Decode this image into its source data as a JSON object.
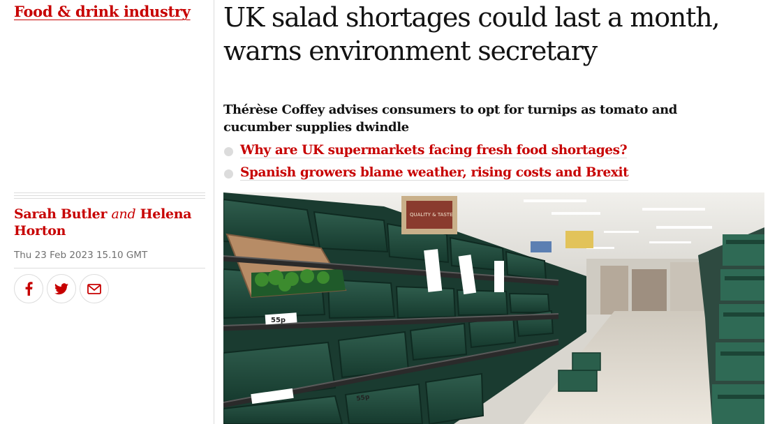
{
  "section": {
    "label": "Food & drink industry"
  },
  "article": {
    "headline_line1": "UK salad shortages could last a month,",
    "headline_line2": "warns environment secretary",
    "standfirst": "Thérèse Coffey advises consumers to opt for turnips as tomato and cucumber supplies dwindle",
    "related": [
      {
        "label": "Why are UK supermarkets facing fresh food shortages?"
      },
      {
        "label": "Spanish growers blame weather, rising costs and Brexit"
      }
    ]
  },
  "byline": {
    "author1": "Sarah Butler",
    "conjunction": "and",
    "author2": "Helena Horton"
  },
  "dateline": "Thu 23 Feb 2023 15.10 GMT",
  "share": {
    "icons": [
      "facebook-icon",
      "twitter-icon",
      "email-icon"
    ]
  },
  "image": {
    "shelf_label_1": "55p",
    "shelf_label_2": "55p",
    "sign_text": "QUALITY & TASTE",
    "description_colors": {
      "crates": "#1f4a3c",
      "shelf_edge": "#2b2b2b",
      "floor": "#e6e1d8",
      "ceiling": "#ecebe7"
    }
  },
  "colors": {
    "accent": "#c70000",
    "text": "#121212",
    "muted": "#707070",
    "rule": "#dcdcdc"
  }
}
